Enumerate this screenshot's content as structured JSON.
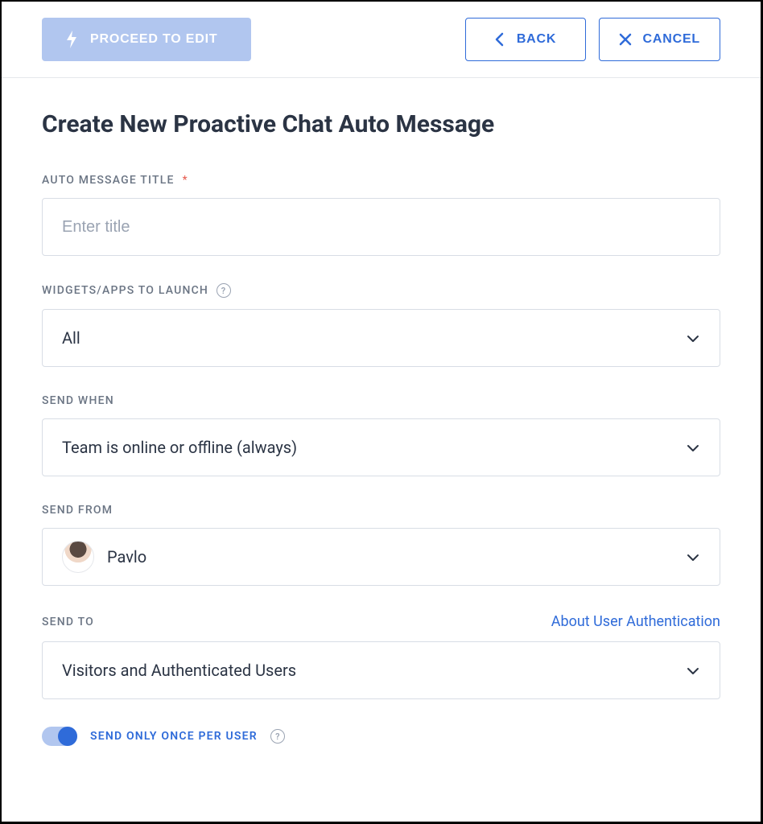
{
  "toolbar": {
    "proceed_label": "PROCEED TO EDIT",
    "back_label": "BACK",
    "cancel_label": "CANCEL"
  },
  "page": {
    "title": "Create New Proactive Chat Auto Message"
  },
  "fields": {
    "title": {
      "label": "AUTO MESSAGE TITLE",
      "required_marker": "*",
      "placeholder": "Enter title",
      "value": ""
    },
    "widgets": {
      "label": "WIDGETS/APPS TO LAUNCH",
      "value": "All"
    },
    "send_when": {
      "label": "SEND WHEN",
      "value": "Team is online or offline (always)"
    },
    "send_from": {
      "label": "SEND FROM",
      "value": "Pavlo"
    },
    "send_to": {
      "label": "SEND TO",
      "help_link": "About User Authentication",
      "value": "Visitors and Authenticated Users"
    }
  },
  "toggle": {
    "label": "SEND ONLY ONCE PER USER",
    "on": true
  },
  "icons": {
    "help_glyph": "?"
  }
}
